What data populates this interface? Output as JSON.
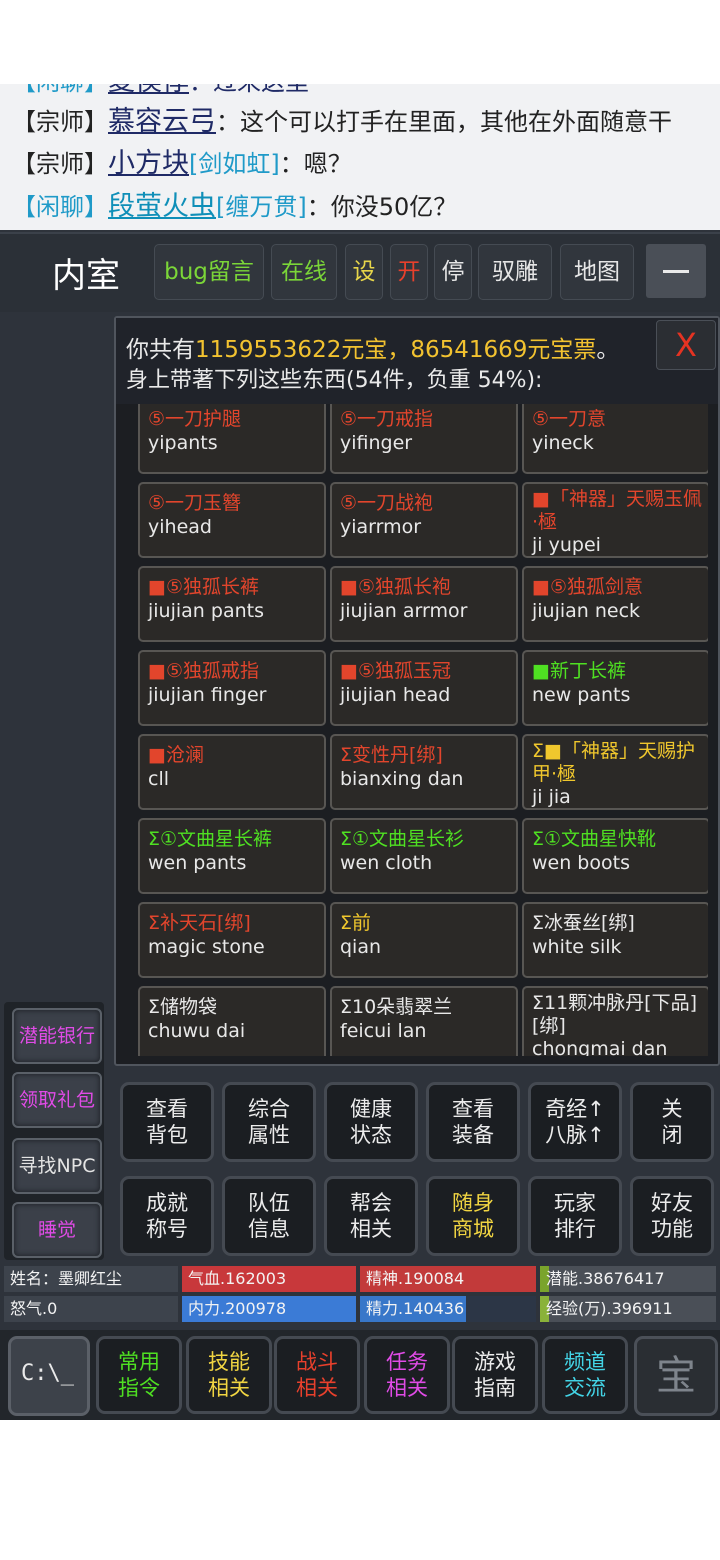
{
  "chat": {
    "partial_line": {
      "tag": "【闲聊】",
      "name": "夏侯惇",
      "text": "：过来这里"
    },
    "lines": [
      {
        "tag": "【宗师】",
        "name": "慕容云弓",
        "sect": "",
        "text": "：这个可以打手在里面，其他在外面随意干"
      },
      {
        "tag": "【宗师】",
        "name": "小方块",
        "sect": "[剑如虹]",
        "text": "：嗯？"
      },
      {
        "tag": "【闲聊】",
        "name": "段萤火虫",
        "sect": "[缠万贯]",
        "text": "：你没50亿？"
      }
    ]
  },
  "nav": {
    "room": "内室",
    "buttons": [
      {
        "label": "bug留言"
      },
      {
        "label": "在线"
      },
      {
        "label": "设"
      },
      {
        "label": "开"
      },
      {
        "label": "停"
      },
      {
        "label": "驭雕"
      },
      {
        "label": "地图"
      }
    ],
    "minimize_icon": "minimize-icon"
  },
  "sidebar": {
    "buttons": [
      {
        "label": "潜能银行"
      },
      {
        "label": "领取礼包"
      },
      {
        "label": "寻找NPC"
      },
      {
        "label": "睡觉"
      }
    ]
  },
  "inventory": {
    "line1_prefix": "你共有",
    "yuanbao": "1159553622元宝，86541669元宝票",
    "line1_suffix": "。",
    "line2": "身上带著下列这些东西(54件，负重 54%):",
    "close": "X",
    "items": [
      {
        "name": "⑤一刀护腿",
        "id": "yipants"
      },
      {
        "name": "⑤一刀戒指",
        "id": "yifinger"
      },
      {
        "name": "⑤一刀意",
        "id": "yineck"
      },
      {
        "name": "⑤一刀玉簪",
        "id": "yihead"
      },
      {
        "name": "⑤一刀战袍",
        "id": "yiarrmor"
      },
      {
        "name": "■「神器」天赐玉佩·極",
        "id": "ji yupei"
      },
      {
        "name": "■⑤独孤长裤",
        "id": "jiujian pants"
      },
      {
        "name": "■⑤独孤长袍",
        "id": "jiujian arrmor"
      },
      {
        "name": "■⑤独孤剑意",
        "id": "jiujian neck"
      },
      {
        "name": "■⑤独孤戒指",
        "id": "jiujian finger"
      },
      {
        "name": "■⑤独孤玉冠",
        "id": "jiujian head"
      },
      {
        "name": "■新丁长裤",
        "id": "new pants"
      },
      {
        "name": "■沧澜",
        "id": "cll"
      },
      {
        "name": "Σ变性丹[绑]",
        "id": "bianxing dan"
      },
      {
        "name": "Σ■「神器」天赐护甲·極",
        "id": "ji jia"
      },
      {
        "name": "Σ①文曲星长裤",
        "id": "wen pants"
      },
      {
        "name": "Σ①文曲星长衫",
        "id": "wen cloth"
      },
      {
        "name": "Σ①文曲星快靴",
        "id": "wen boots"
      },
      {
        "name": "Σ补天石[绑]",
        "id": "magic stone"
      },
      {
        "name": "Σ前",
        "id": "qian"
      },
      {
        "name": "Σ冰蚕丝[绑]",
        "id": "white silk"
      },
      {
        "name": "Σ储物袋",
        "id": "chuwu dai"
      },
      {
        "name": "Σ10朵翡翠兰",
        "id": "feicui lan"
      },
      {
        "name": "Σ11颗冲脉丹[下品][绑]",
        "id": "chongmai dan"
      }
    ]
  },
  "actions": {
    "row1": [
      "查看\n背包",
      "综合\n属性",
      "健康\n状态",
      "查看\n装备",
      "奇经↑\n八脉↑",
      "关\n闭"
    ],
    "row2": [
      "成就\n称号",
      "队伍\n信息",
      "帮会\n相关",
      "随身\n商城",
      "玩家\n排行",
      "好友\n功能"
    ]
  },
  "stats": {
    "name": "姓名：墨卿红尘",
    "qixue": "气血.162003",
    "jingshen": "精神.190084",
    "qianneng": "潜能.38676417",
    "nuqi": "怒气.0",
    "neili": "内力.200978",
    "jingli": "精力.140436",
    "jingyan": "经验(万).396911",
    "fill": {
      "qixue": 1.0,
      "jingshen": 1.0,
      "qianneng": 0.05,
      "neili": 1.0,
      "jingli": 0.6,
      "jingyan": 0.05
    }
  },
  "bottom": {
    "console_glyph": "C:\\_",
    "buttons": [
      "常用\n指令",
      "技能\n相关",
      "战斗\n相关",
      "任务\n相关",
      "游戏\n指南",
      "频道\n交流"
    ],
    "char_glyph": "宝"
  }
}
